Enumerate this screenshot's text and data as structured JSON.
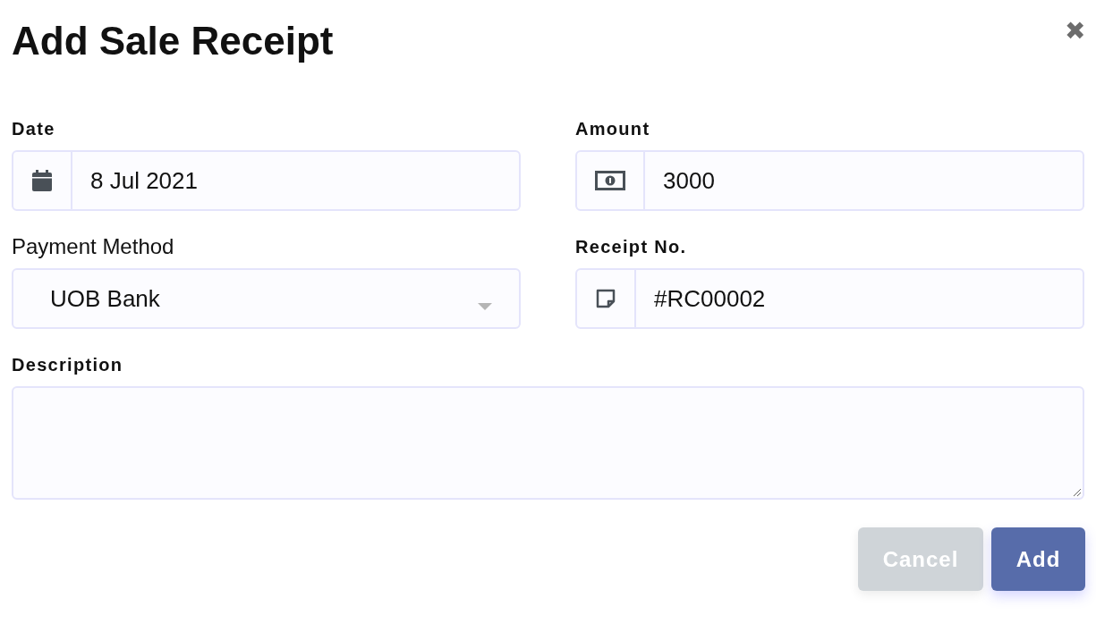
{
  "dialog": {
    "title": "Add Sale Receipt",
    "close": "✖"
  },
  "fields": [
    {
      "kind": "icon-input",
      "label": "Date",
      "label_bold": true,
      "value": "8 Jul 2021"
    },
    {
      "kind": "icon-input",
      "label": "Amount",
      "label_bold": true,
      "value": "3000"
    },
    {
      "kind": "select",
      "label": "Payment Method",
      "label_bold": false,
      "value": "UOB Bank"
    },
    {
      "kind": "icon-input",
      "label": "Receipt No.",
      "label_bold": true,
      "value": "#RC00002"
    },
    {
      "kind": "textarea",
      "label": "Description",
      "label_bold": true
    }
  ],
  "buttons": [
    {
      "label": "Cancel",
      "kind": "secondary"
    },
    {
      "label": "Add",
      "kind": "primary"
    }
  ]
}
